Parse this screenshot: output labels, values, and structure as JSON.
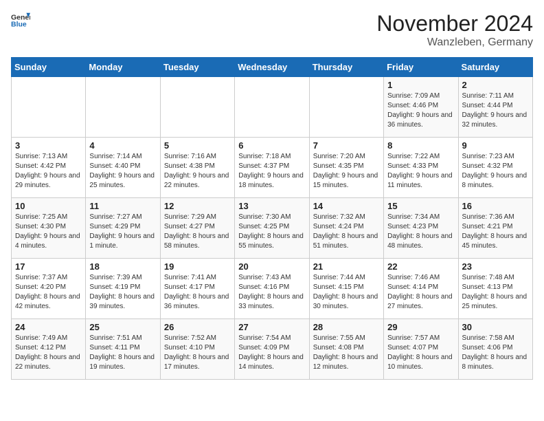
{
  "logo": {
    "general": "General",
    "blue": "Blue"
  },
  "header": {
    "month": "November 2024",
    "location": "Wanzleben, Germany"
  },
  "days_of_week": [
    "Sunday",
    "Monday",
    "Tuesday",
    "Wednesday",
    "Thursday",
    "Friday",
    "Saturday"
  ],
  "weeks": [
    [
      {
        "day": "",
        "info": ""
      },
      {
        "day": "",
        "info": ""
      },
      {
        "day": "",
        "info": ""
      },
      {
        "day": "",
        "info": ""
      },
      {
        "day": "",
        "info": ""
      },
      {
        "day": "1",
        "info": "Sunrise: 7:09 AM\nSunset: 4:46 PM\nDaylight: 9 hours and 36 minutes."
      },
      {
        "day": "2",
        "info": "Sunrise: 7:11 AM\nSunset: 4:44 PM\nDaylight: 9 hours and 32 minutes."
      }
    ],
    [
      {
        "day": "3",
        "info": "Sunrise: 7:13 AM\nSunset: 4:42 PM\nDaylight: 9 hours and 29 minutes."
      },
      {
        "day": "4",
        "info": "Sunrise: 7:14 AM\nSunset: 4:40 PM\nDaylight: 9 hours and 25 minutes."
      },
      {
        "day": "5",
        "info": "Sunrise: 7:16 AM\nSunset: 4:38 PM\nDaylight: 9 hours and 22 minutes."
      },
      {
        "day": "6",
        "info": "Sunrise: 7:18 AM\nSunset: 4:37 PM\nDaylight: 9 hours and 18 minutes."
      },
      {
        "day": "7",
        "info": "Sunrise: 7:20 AM\nSunset: 4:35 PM\nDaylight: 9 hours and 15 minutes."
      },
      {
        "day": "8",
        "info": "Sunrise: 7:22 AM\nSunset: 4:33 PM\nDaylight: 9 hours and 11 minutes."
      },
      {
        "day": "9",
        "info": "Sunrise: 7:23 AM\nSunset: 4:32 PM\nDaylight: 9 hours and 8 minutes."
      }
    ],
    [
      {
        "day": "10",
        "info": "Sunrise: 7:25 AM\nSunset: 4:30 PM\nDaylight: 9 hours and 4 minutes."
      },
      {
        "day": "11",
        "info": "Sunrise: 7:27 AM\nSunset: 4:29 PM\nDaylight: 9 hours and 1 minute."
      },
      {
        "day": "12",
        "info": "Sunrise: 7:29 AM\nSunset: 4:27 PM\nDaylight: 8 hours and 58 minutes."
      },
      {
        "day": "13",
        "info": "Sunrise: 7:30 AM\nSunset: 4:25 PM\nDaylight: 8 hours and 55 minutes."
      },
      {
        "day": "14",
        "info": "Sunrise: 7:32 AM\nSunset: 4:24 PM\nDaylight: 8 hours and 51 minutes."
      },
      {
        "day": "15",
        "info": "Sunrise: 7:34 AM\nSunset: 4:23 PM\nDaylight: 8 hours and 48 minutes."
      },
      {
        "day": "16",
        "info": "Sunrise: 7:36 AM\nSunset: 4:21 PM\nDaylight: 8 hours and 45 minutes."
      }
    ],
    [
      {
        "day": "17",
        "info": "Sunrise: 7:37 AM\nSunset: 4:20 PM\nDaylight: 8 hours and 42 minutes."
      },
      {
        "day": "18",
        "info": "Sunrise: 7:39 AM\nSunset: 4:19 PM\nDaylight: 8 hours and 39 minutes."
      },
      {
        "day": "19",
        "info": "Sunrise: 7:41 AM\nSunset: 4:17 PM\nDaylight: 8 hours and 36 minutes."
      },
      {
        "day": "20",
        "info": "Sunrise: 7:43 AM\nSunset: 4:16 PM\nDaylight: 8 hours and 33 minutes."
      },
      {
        "day": "21",
        "info": "Sunrise: 7:44 AM\nSunset: 4:15 PM\nDaylight: 8 hours and 30 minutes."
      },
      {
        "day": "22",
        "info": "Sunrise: 7:46 AM\nSunset: 4:14 PM\nDaylight: 8 hours and 27 minutes."
      },
      {
        "day": "23",
        "info": "Sunrise: 7:48 AM\nSunset: 4:13 PM\nDaylight: 8 hours and 25 minutes."
      }
    ],
    [
      {
        "day": "24",
        "info": "Sunrise: 7:49 AM\nSunset: 4:12 PM\nDaylight: 8 hours and 22 minutes."
      },
      {
        "day": "25",
        "info": "Sunrise: 7:51 AM\nSunset: 4:11 PM\nDaylight: 8 hours and 19 minutes."
      },
      {
        "day": "26",
        "info": "Sunrise: 7:52 AM\nSunset: 4:10 PM\nDaylight: 8 hours and 17 minutes."
      },
      {
        "day": "27",
        "info": "Sunrise: 7:54 AM\nSunset: 4:09 PM\nDaylight: 8 hours and 14 minutes."
      },
      {
        "day": "28",
        "info": "Sunrise: 7:55 AM\nSunset: 4:08 PM\nDaylight: 8 hours and 12 minutes."
      },
      {
        "day": "29",
        "info": "Sunrise: 7:57 AM\nSunset: 4:07 PM\nDaylight: 8 hours and 10 minutes."
      },
      {
        "day": "30",
        "info": "Sunrise: 7:58 AM\nSunset: 4:06 PM\nDaylight: 8 hours and 8 minutes."
      }
    ]
  ]
}
